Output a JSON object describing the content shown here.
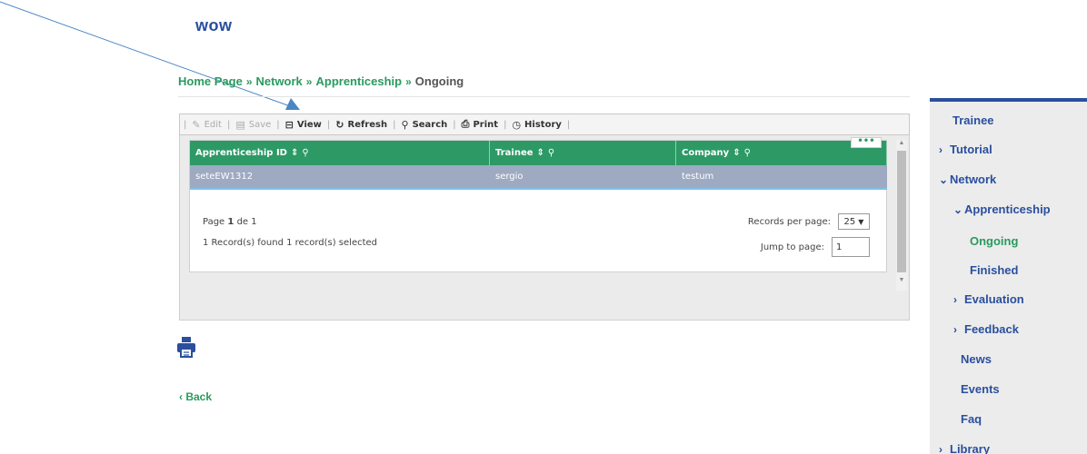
{
  "app": {
    "title": "wow"
  },
  "breadcrumb": {
    "items": [
      "Home Page",
      "Network",
      "Apprenticeship"
    ],
    "separator": "»",
    "current": "Ongoing"
  },
  "toolbar": {
    "edit": "Edit",
    "save": "Save",
    "view": "View",
    "refresh": "Refresh",
    "search": "Search",
    "print": "Print",
    "history": "History",
    "separator": "|"
  },
  "grid": {
    "columns": [
      "Apprenticeship ID",
      "Trainee",
      "Company"
    ],
    "rows": [
      [
        "seteEW1312",
        "sergio",
        "testum"
      ]
    ],
    "menu_label": "•••"
  },
  "pager": {
    "page_prefix": "Page",
    "page_current": "1",
    "page_of": "de",
    "page_total": "1",
    "records_status": "1 Record(s) found 1 record(s) selected",
    "records_per_page_label": "Records per page:",
    "records_per_page_value": "25",
    "jump_label": "Jump to page:",
    "jump_value": "1"
  },
  "back": {
    "label": "Back"
  },
  "sidebar": {
    "items": [
      {
        "label": "Trainee",
        "chevron": ""
      },
      {
        "label": "Tutorial",
        "chevron": "›"
      },
      {
        "label": "Network",
        "chevron": "⌄"
      },
      {
        "label": "Apprenticeship",
        "chevron": "⌄"
      },
      {
        "label": "Ongoing",
        "chevron": "",
        "active": true
      },
      {
        "label": "Finished",
        "chevron": ""
      },
      {
        "label": "Evaluation",
        "chevron": "›"
      },
      {
        "label": "Feedback",
        "chevron": "›"
      },
      {
        "label": "News",
        "chevron": ""
      },
      {
        "label": "Events",
        "chevron": ""
      },
      {
        "label": "Faq",
        "chevron": ""
      },
      {
        "label": "Library",
        "chevron": "›"
      }
    ]
  },
  "colors": {
    "brand_blue": "#2a4f9e",
    "brand_green": "#2a9a5e",
    "grid_header": "#2d9a66",
    "selected_row": "#9eaac2",
    "annotation_arrow": "#4a86c5"
  }
}
